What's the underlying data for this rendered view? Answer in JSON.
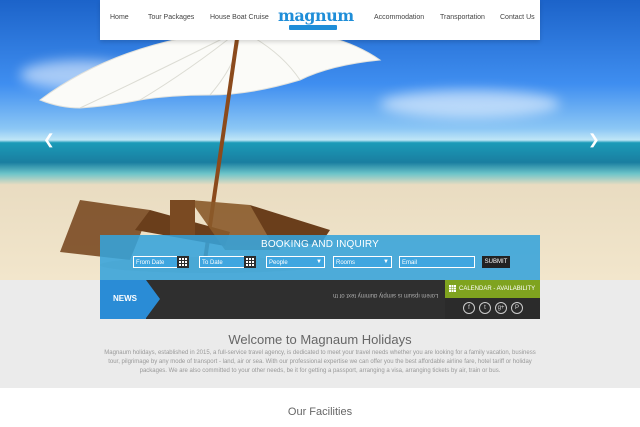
{
  "nav": {
    "left": [
      "Home",
      "Tour Packages",
      "House Boat Cruise"
    ],
    "right": [
      "Accommodation",
      "Transportation",
      "Contact Us"
    ],
    "logo": "magnum"
  },
  "booking": {
    "title": "BOOKING AND INQUIRY",
    "from_date": "From Date",
    "to_date": "To Date",
    "people": "People",
    "rooms": "Rooms",
    "email": "Email",
    "submit": "SUBMIT"
  },
  "news": {
    "label": "NEWS",
    "ticker": "Lorem ipsum is simply dummy text of th"
  },
  "calendar": {
    "label": "CALENDAR - AVAILABILITY"
  },
  "social": {
    "facebook": "f",
    "tumblr": "t",
    "gplus": "g+",
    "pinterest": "P"
  },
  "welcome": {
    "title": "Welcome to Magnaum Holidays",
    "text": "Magnaum holidays, established in 2015, a full-service travel agency, is dedicated to meet your travel needs whether you are looking for a family vacation, business tour, pilgrimage by any mode of transport - land, air or sea. With our professional expertise we can offer you the best affordable airline fare, hotel tariff or holiday packages. We are also committed to your other needs, be it for getting a passport, arranging a visa, arranging tickets by air, train or bus."
  },
  "facilities": {
    "title": "Our Facilities"
  },
  "colors": {
    "accent": "#2a8cd6",
    "calendar": "#7fa31f",
    "booking": "#36a3db"
  },
  "icons": {
    "prev": "chevron-left-icon",
    "next": "chevron-right-icon",
    "calendar": "grid-icon"
  }
}
